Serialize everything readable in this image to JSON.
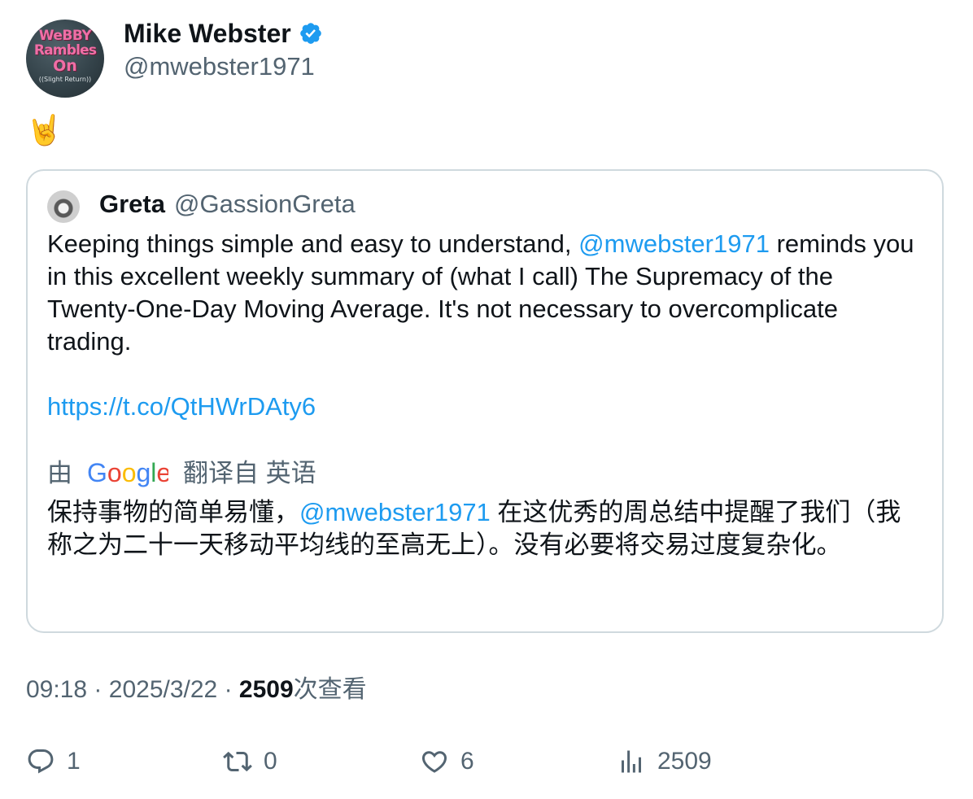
{
  "author": {
    "name": "Mike Webster",
    "handle": "@mwebster1971",
    "avatar_text": [
      "WeBBY",
      "Rambles",
      "On",
      "((Slight Return))"
    ],
    "verified": true
  },
  "tweet": {
    "text": "🤘"
  },
  "quote": {
    "author_name": "Greta",
    "author_handle": "@GassionGreta",
    "text_before_mention": "Keeping things simple and easy to understand, ",
    "mention": "@mwebster1971",
    "text_after_mention": " reminds you in this excellent weekly summary of (what I call) The Supremacy of the Twenty-One-Day Moving Average. It's not necessary to overcomplicate trading.",
    "link": "https://t.co/QtHWrDAty6",
    "translation": {
      "by_label": "由",
      "provider": "Google",
      "from_label": "翻译自 英语",
      "text_before_mention": "保持事物的简单易懂，",
      "mention": "@mwebster1971",
      "text_after_mention": " 在这优秀的周总结中提醒了我们（我称之为二十一天移动平均线的至高无上）。没有必要将交易过度复杂化。"
    }
  },
  "meta": {
    "time": "09:18",
    "separator": "·",
    "date": "2025/3/22",
    "views_count": "2509",
    "views_label": "次查看"
  },
  "actions": {
    "reply_count": "1",
    "retweet_count": "0",
    "like_count": "6",
    "views_count": "2509"
  },
  "colors": {
    "accent": "#1d9bf0",
    "text_primary": "#0f1419",
    "text_secondary": "#536471",
    "border": "#cfd9de"
  }
}
